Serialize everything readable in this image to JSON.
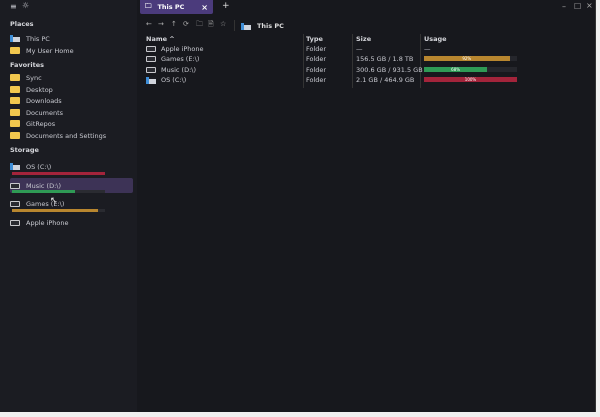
{
  "toolbar_top": {
    "menu_icon": "hamburger-icon",
    "settings_icon": "sun-icon"
  },
  "tab": {
    "label": "This PC",
    "close": "×",
    "new_tab": "+"
  },
  "window_controls": {
    "minimize": "–",
    "maximize": "☐",
    "close": "×"
  },
  "path": {
    "label": "This PC"
  },
  "sidebar": {
    "places_title": "Places",
    "places": [
      {
        "label": "This PC",
        "icon": "pc"
      },
      {
        "label": "My User Home",
        "icon": "folder"
      }
    ],
    "favorites_title": "Favorites",
    "favorites": [
      "Sync",
      "Desktop",
      "Downloads",
      "Documents",
      "GitRepos",
      "Documents and Settings"
    ],
    "storage_title": "Storage",
    "storage": [
      {
        "label": "OS (C:\\)",
        "usage": 100,
        "color": "#a3243b"
      },
      {
        "label": "Music (D:\\)",
        "usage": 68,
        "color": "#2f9a55"
      },
      {
        "label": "Games (E:\\)",
        "usage": 92,
        "color": "#b8862f"
      },
      {
        "label": "Apple iPhone"
      }
    ]
  },
  "table": {
    "headers": {
      "name": "Name ^",
      "type": "Type",
      "size": "Size",
      "usage": "Usage"
    },
    "rows": [
      {
        "name": "Apple iPhone",
        "type": "Folder",
        "size": "—",
        "usage_text": "—"
      },
      {
        "name": "Games (E:\\)",
        "type": "Folder",
        "size": "156.5 GB / 1.8 TB",
        "usage": 92,
        "usage_text": "92%",
        "color": "#b8862f"
      },
      {
        "name": "Music (D:\\)",
        "type": "Folder",
        "size": "300.6 GB / 931.5 GB",
        "usage": 68,
        "usage_text": "68%",
        "color": "#2f9a55"
      },
      {
        "name": "OS (C:\\)",
        "type": "Folder",
        "size": "2.1 GB / 464.9 GB",
        "usage": 100,
        "usage_text": "100%",
        "color": "#a3243b"
      }
    ]
  }
}
